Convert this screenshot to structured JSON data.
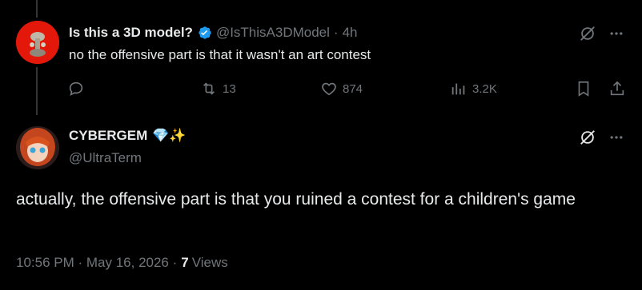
{
  "reply_tweet": {
    "display_name": "Is this a 3D model?",
    "handle": "@IsThisA3DModel",
    "separator": "·",
    "time": "4h",
    "text": "no the offensive part is that it wasn't an art contest",
    "actions": {
      "reply_count": "",
      "retweet_count": "13",
      "like_count": "874",
      "views_count": "3.2K"
    }
  },
  "main_tweet": {
    "display_name": "CYBERGEM",
    "name_emoji": "💎✨",
    "handle": "@UltraTerm",
    "text": "actually, the offensive part is that you ruined a contest for a children's game",
    "timestamp": "10:56 PM · May 16, 2026 ·",
    "views_count": "7",
    "views_label": "Views"
  },
  "colors": {
    "background": "#000000",
    "primary_text": "#e7e9ea",
    "secondary_text": "#71767b",
    "verified_blue": "#1d9bf0"
  }
}
